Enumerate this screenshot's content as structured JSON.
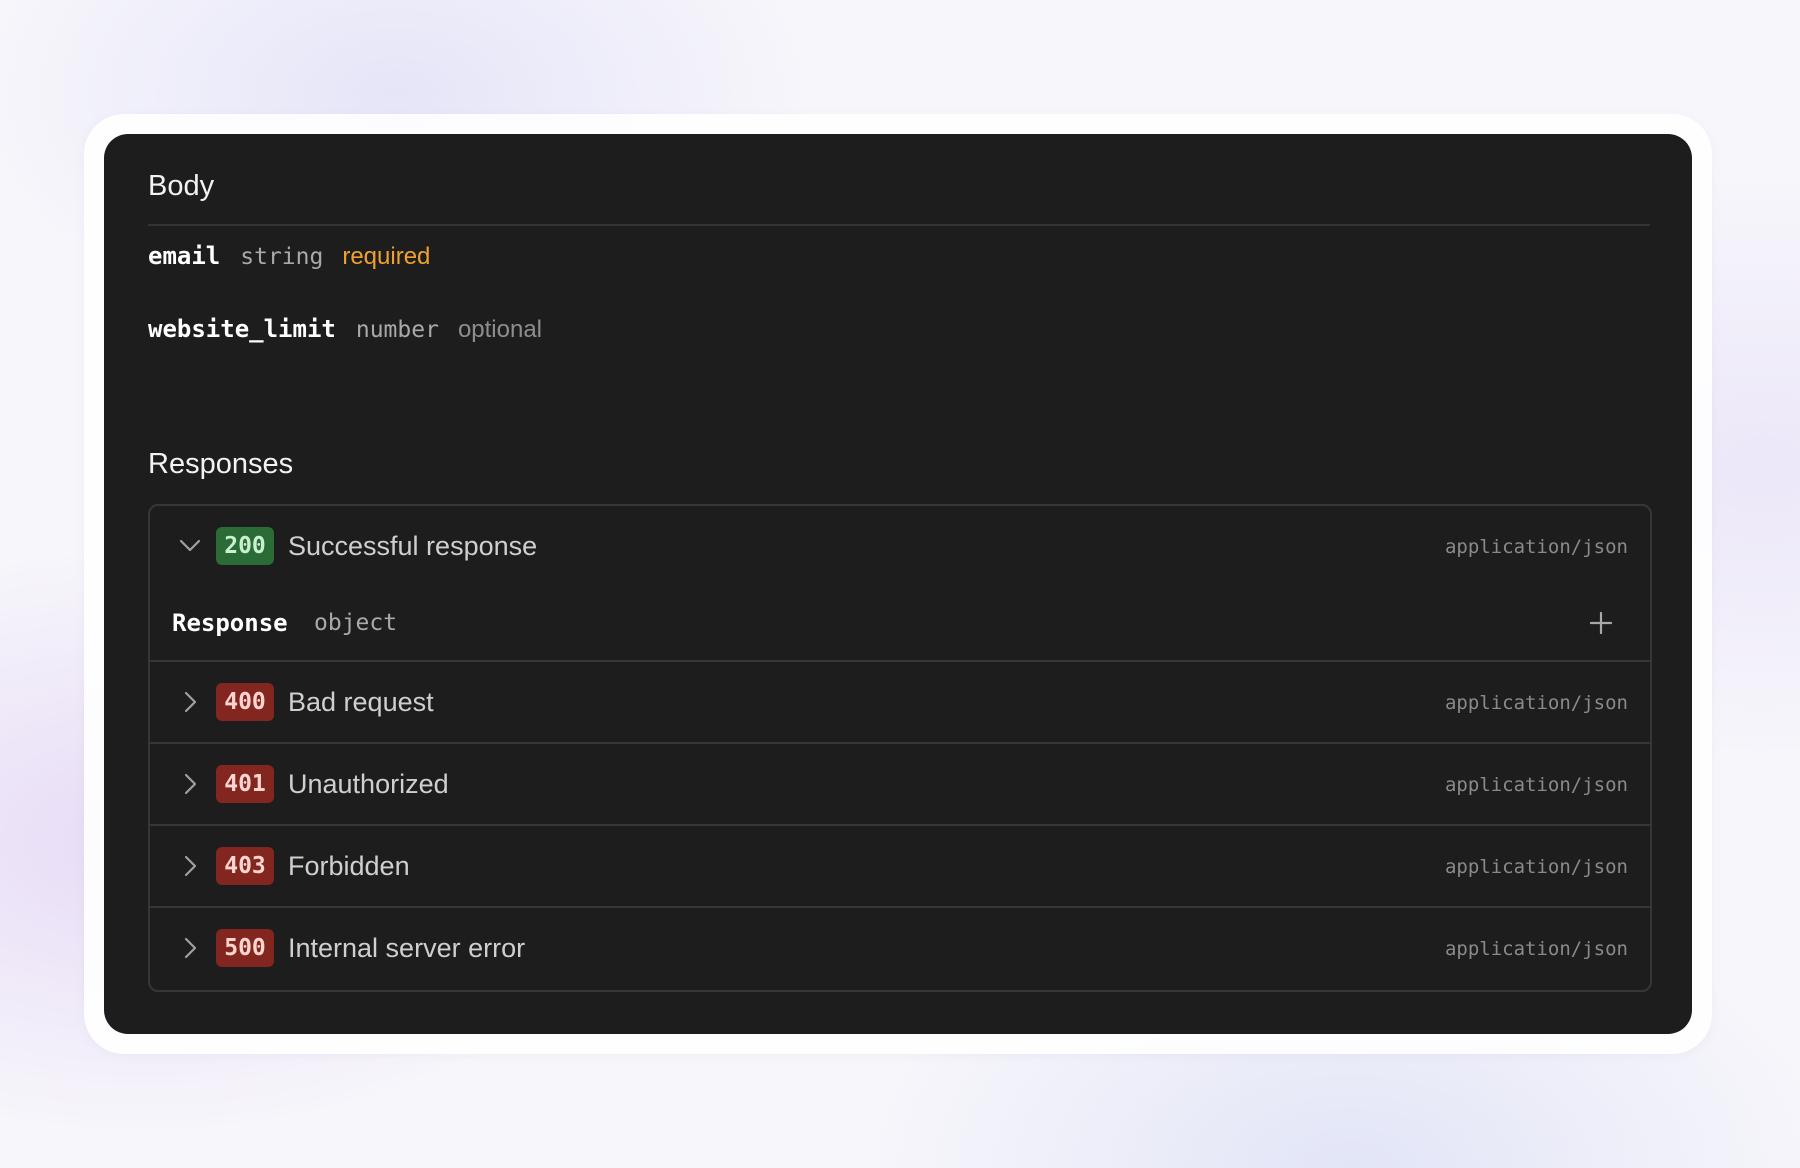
{
  "body_section": {
    "title": "Body",
    "params": [
      {
        "name": "email",
        "type": "string",
        "flag": "required"
      },
      {
        "name": "website_limit",
        "type": "number",
        "flag": "optional"
      }
    ]
  },
  "responses_section": {
    "title": "Responses",
    "items": [
      {
        "code": "200",
        "label": "Successful response",
        "content_type": "application/json",
        "expanded": true,
        "status": "success"
      },
      {
        "code": "400",
        "label": "Bad request",
        "content_type": "application/json",
        "expanded": false,
        "status": "error"
      },
      {
        "code": "401",
        "label": "Unauthorized",
        "content_type": "application/json",
        "expanded": false,
        "status": "error"
      },
      {
        "code": "403",
        "label": "Forbidden",
        "content_type": "application/json",
        "expanded": false,
        "status": "error"
      },
      {
        "code": "500",
        "label": "Internal server error",
        "content_type": "application/json",
        "expanded": false,
        "status": "error"
      }
    ],
    "response_object": {
      "name": "Response",
      "type": "object"
    }
  },
  "icons": {
    "collapse": "chevron-down-icon",
    "expand": "chevron-right-icon",
    "add": "plus-icon"
  },
  "colors": {
    "panel": "#1d1d1d",
    "required": "#f0a030",
    "success_badge": "#2a6b36",
    "error_badge": "#83261f"
  }
}
